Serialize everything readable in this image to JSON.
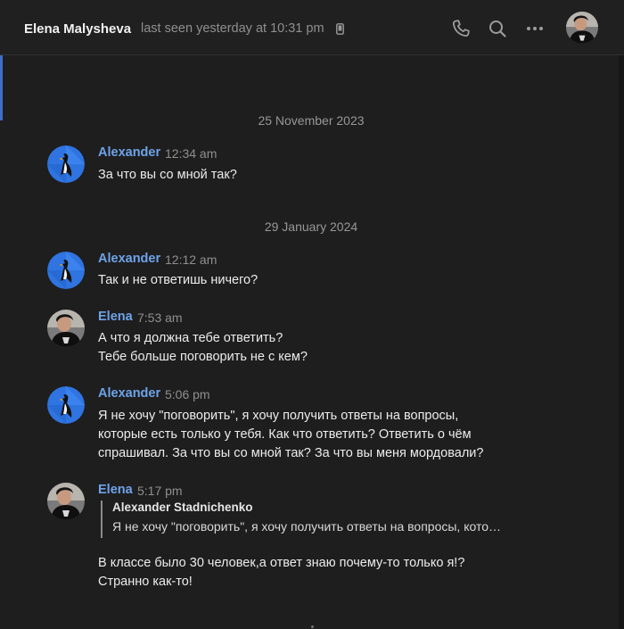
{
  "header": {
    "name": "Elena Malysheva",
    "status": "last seen yesterday at 10:31 pm",
    "icons": [
      "phone-icon",
      "search-icon",
      "more-icon",
      "device-icon"
    ]
  },
  "dates": [
    "25 November 2023",
    "29 January 2024"
  ],
  "messages": [
    {
      "author": "Alexander",
      "time": "12:34 am",
      "lines": [
        "За что вы со мной так?"
      ]
    },
    {
      "author": "Alexander",
      "time": "12:12 am",
      "lines": [
        "Так и не ответишь ничего?"
      ]
    },
    {
      "author": "Elena",
      "time": "7:53 am",
      "lines": [
        "А что я должна тебе ответить?",
        "Тебе больше поговорить не с кем?"
      ]
    },
    {
      "author": "Alexander",
      "time": "5:06 pm",
      "lines": [
        "Я не хочу \"поговорить\", я хочу получить ответы на вопросы,",
        "которые есть только у тебя. Как что ответить? Ответить о чём",
        "спрашивал. За что вы со мной так? За что вы меня мордовали?"
      ]
    },
    {
      "author": "Elena",
      "time": "5:17 pm",
      "reply": {
        "author": "Alexander Stadnichenko",
        "text": "Я не хочу \"поговорить\", я хочу получить ответы на вопросы, кото…"
      },
      "lines": [
        "В классе было 30 человек,а ответ знаю почему-то только я!?",
        "Странно как-то!"
      ]
    }
  ],
  "colors": {
    "background": "#1e1e1f",
    "author_name": "#6fa3e8",
    "avatar_blue": "#2f74e0",
    "accent": "#3d6fc7"
  }
}
